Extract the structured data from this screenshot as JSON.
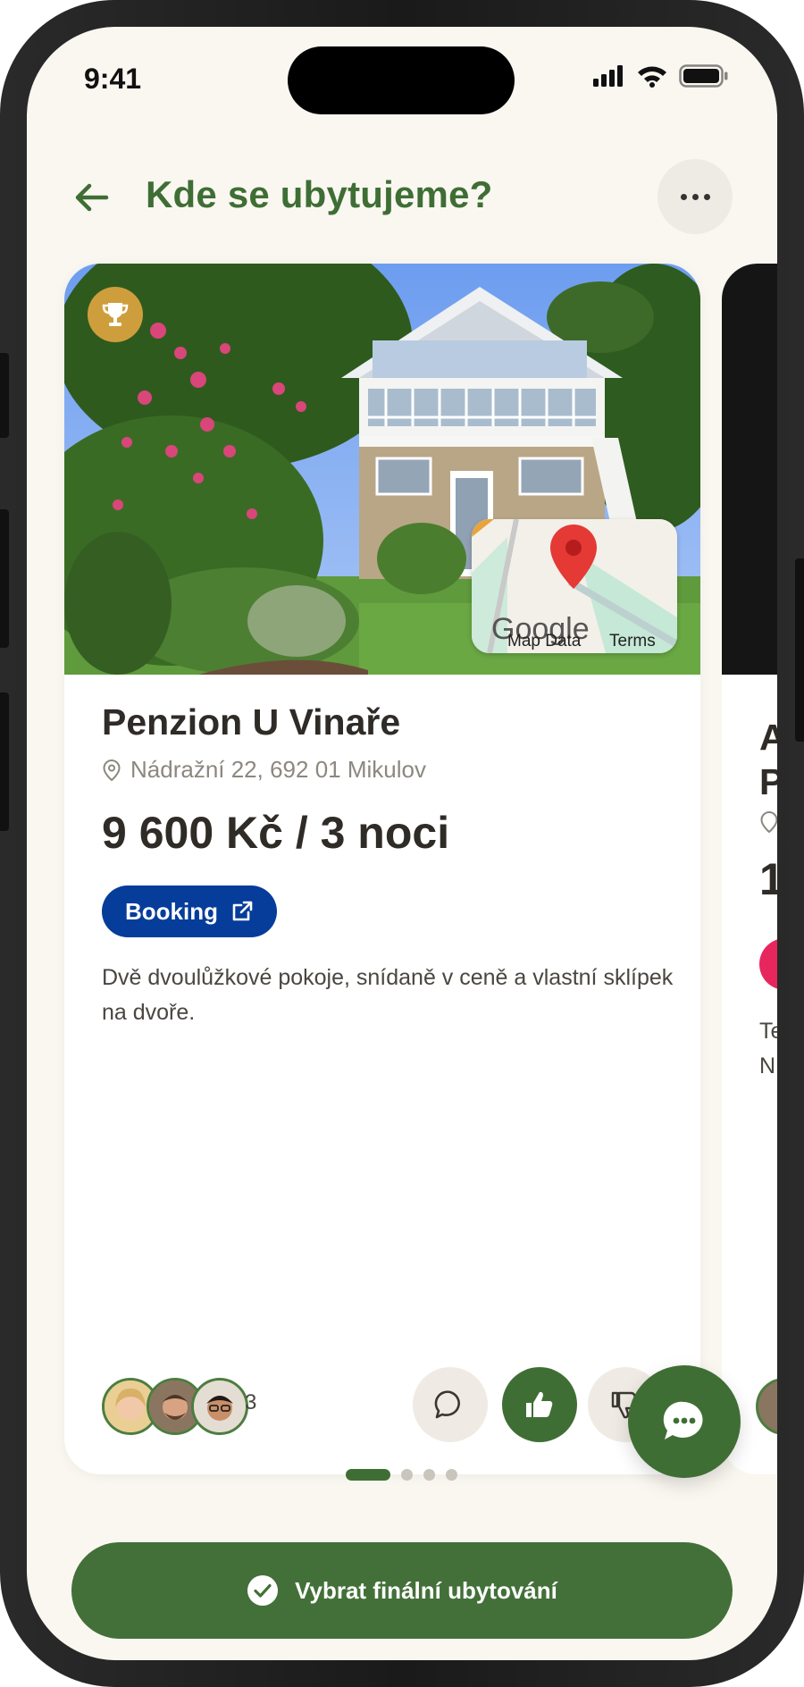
{
  "status_bar": {
    "time": "9:41"
  },
  "header": {
    "title": "Kde se ubytujeme?"
  },
  "card": {
    "name": "Penzion U Vinaře",
    "address": "Nádražní 22, 692 01 Mikulov",
    "price": "9 600 Kč / 3 noci",
    "booking_label": "Booking",
    "description": "Dvě dvoulůžkové pokoje, snídaně v ceně a vlastní sklípek na dvoře.",
    "map": {
      "logo": "Google",
      "data_label": "Map Data",
      "terms_label": "Terms"
    },
    "voters_count": "3"
  },
  "next_card": {
    "name_partial_line1": "A",
    "name_partial_line2": "P",
    "price_partial": "1",
    "desc_partial_line1": "Te",
    "desc_partial_line2": "N"
  },
  "pagination": {
    "total": 4,
    "active": 1
  },
  "cta": {
    "label": "Vybrat finální ubytování"
  },
  "colors": {
    "accent": "#3f6e35",
    "booking": "#063d9a",
    "trophy": "#cf9e3c",
    "background": "#faf7f1"
  }
}
